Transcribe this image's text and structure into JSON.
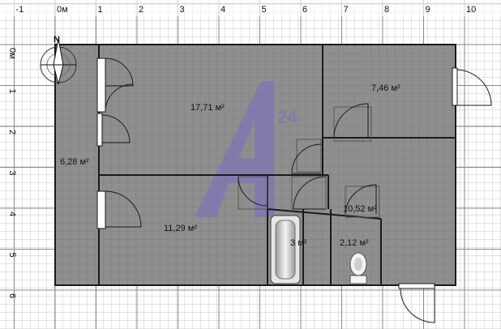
{
  "ruler": {
    "top_ticks": [
      "-1",
      "0м",
      "1",
      "2",
      "3",
      "4",
      "5",
      "6",
      "7",
      "8",
      "9",
      "10"
    ],
    "left_ticks": [
      "0м",
      "1",
      "2",
      "3",
      "4",
      "5",
      "6"
    ]
  },
  "compass": {
    "north_label": "N"
  },
  "rooms": [
    {
      "area": "17,71 м²"
    },
    {
      "area": "7,46 м²"
    },
    {
      "area": "6,28 м²"
    },
    {
      "area": "11,29 м²"
    },
    {
      "area": "10,52 м²"
    },
    {
      "area": "3 м²"
    },
    {
      "area": "2,12 м²"
    }
  ],
  "watermark": {
    "badge": "24"
  },
  "colors": {
    "floor": "#8f8f8f",
    "wall": "#1a1a1a",
    "grid_minor": "#c4c4c4",
    "grid_major": "#8a8a8a",
    "watermark": "#7b6bc4"
  }
}
